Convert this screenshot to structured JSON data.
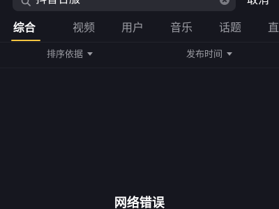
{
  "search": {
    "query": "抖音合服",
    "cancel_label": "取消"
  },
  "tabs": [
    {
      "label": "综合",
      "active": true
    },
    {
      "label": "视频",
      "active": false
    },
    {
      "label": "用户",
      "active": false
    },
    {
      "label": "音乐",
      "active": false
    },
    {
      "label": "话题",
      "active": false
    },
    {
      "label": "直",
      "active": false
    }
  ],
  "filters": {
    "sort_label": "排序依据",
    "time_label": "发布时间"
  },
  "status": {
    "message": "网络错误"
  },
  "colors": {
    "background": "#16171f",
    "accent": "#f4c542",
    "inactive_text": "#9b9ca3"
  },
  "icons": {
    "search": "search-icon",
    "clear": "clear-icon",
    "dropdown": "caret-down-icon"
  }
}
